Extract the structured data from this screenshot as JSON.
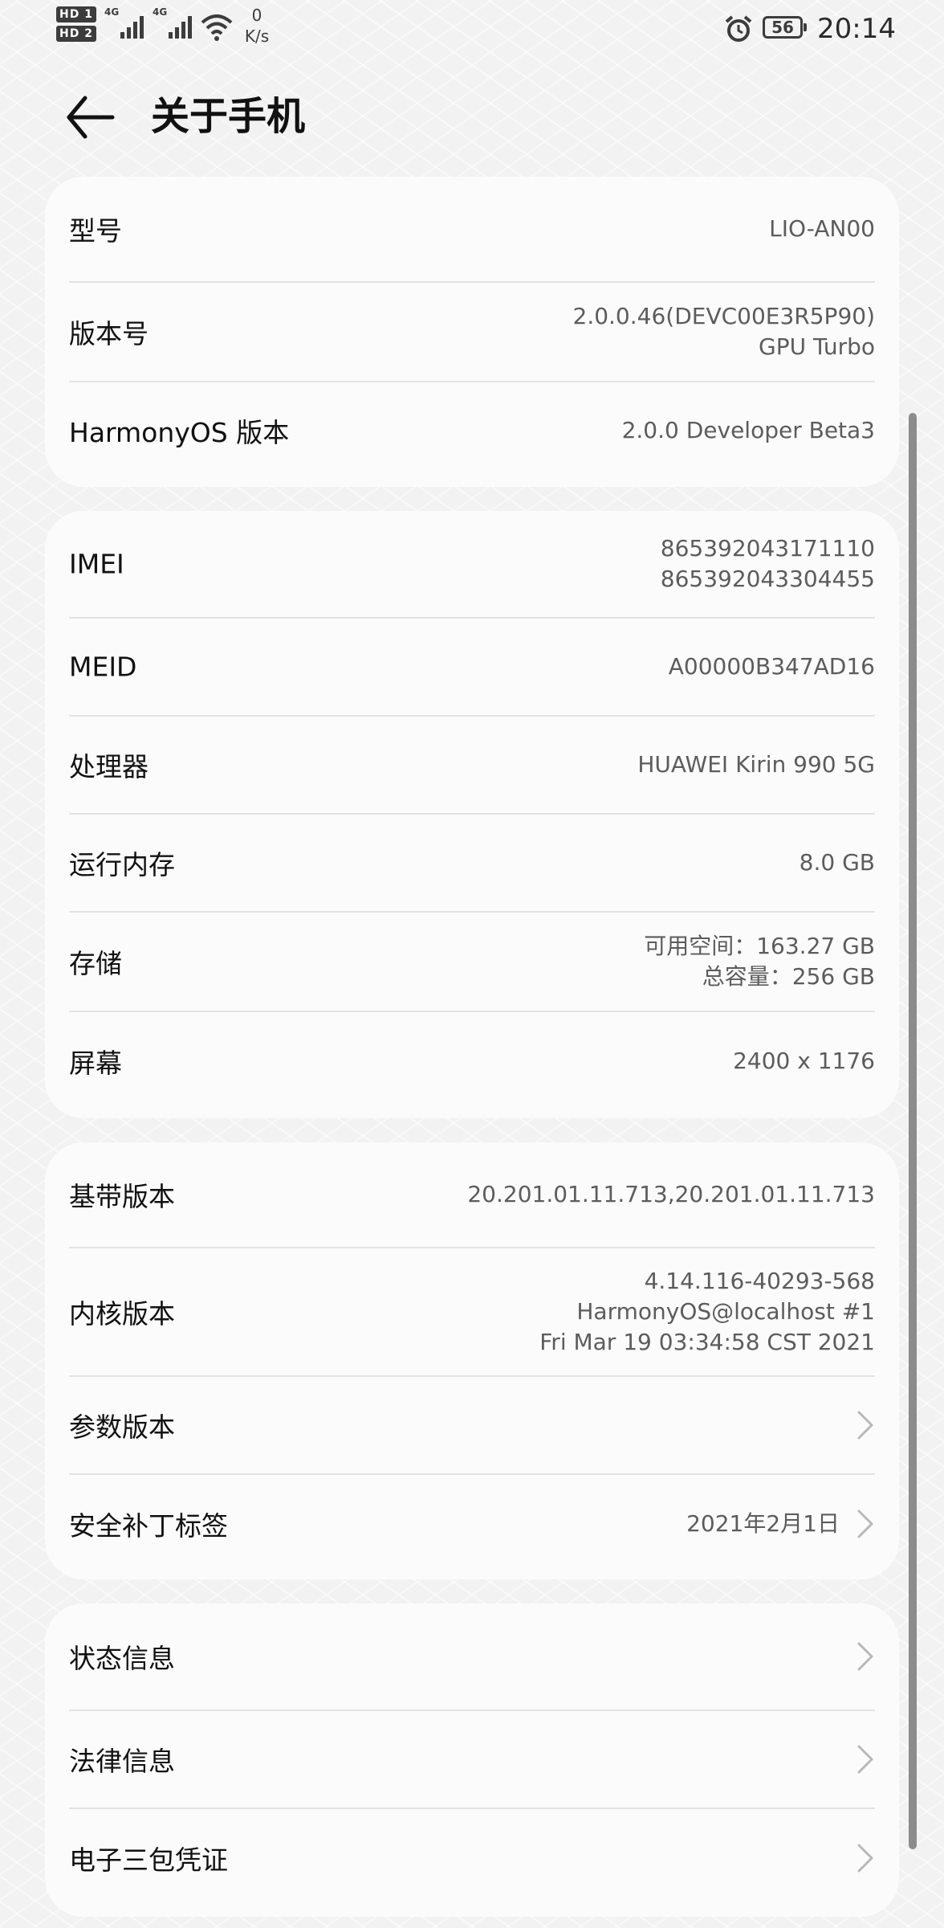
{
  "status_bar": {
    "sim1_badge": "HD 1",
    "sim2_badge": "HD 2",
    "sim1_network": "4G",
    "sim2_network": "4G",
    "speed_value": "0",
    "speed_unit": "K/s",
    "battery_level": "56",
    "time": "20:14",
    "icons": [
      "hd-icon",
      "signal-icon",
      "wifi-icon",
      "alarm-icon",
      "battery-icon"
    ]
  },
  "header": {
    "title": "关于手机",
    "back_icon": "arrow-left-icon"
  },
  "cards": [
    {
      "rows": [
        {
          "label": "型号",
          "value": [
            "LIO-AN00"
          ]
        },
        {
          "label": "版本号",
          "value": [
            "2.0.0.46(DEVC00E3R5P90)",
            "GPU Turbo"
          ]
        },
        {
          "label": "HarmonyOS 版本",
          "value": [
            "2.0.0 Developer Beta3"
          ]
        }
      ]
    },
    {
      "rows": [
        {
          "label": "IMEI",
          "value": [
            "865392043171110",
            "865392043304455"
          ]
        },
        {
          "label": "MEID",
          "value": [
            "A00000B347AD16"
          ]
        },
        {
          "label": "处理器",
          "value": [
            "HUAWEI Kirin 990 5G"
          ]
        },
        {
          "label": "运行内存",
          "value": [
            "8.0 GB"
          ]
        },
        {
          "label": "存储",
          "value": [
            "可用空间：163.27  GB",
            "总容量：256  GB"
          ]
        },
        {
          "label": "屏幕",
          "value": [
            "2400 x 1176"
          ]
        }
      ]
    },
    {
      "rows": [
        {
          "label": "基带版本",
          "value": [
            "20.201.01.11.713,20.201.01.11.713"
          ]
        },
        {
          "label": "内核版本",
          "value": [
            "4.14.116-40293-568",
            "HarmonyOS@localhost #1",
            "Fri Mar 19 03:34:58 CST 2021"
          ]
        },
        {
          "label": "参数版本",
          "value": [],
          "chevron": true
        },
        {
          "label": "安全补丁标签",
          "value": [
            "2021年2月1日"
          ],
          "chevron": true
        }
      ]
    },
    {
      "rows": [
        {
          "label": "状态信息",
          "value": [],
          "chevron": true
        },
        {
          "label": "法律信息",
          "value": [],
          "chevron": true
        },
        {
          "label": "电子三包凭证",
          "value": [],
          "chevron": true
        }
      ]
    }
  ],
  "colors": {
    "card_background": "#fbfbfb",
    "label_text": "#111111",
    "value_text": "#5c5c5c",
    "divider": "#e3e3e3"
  }
}
